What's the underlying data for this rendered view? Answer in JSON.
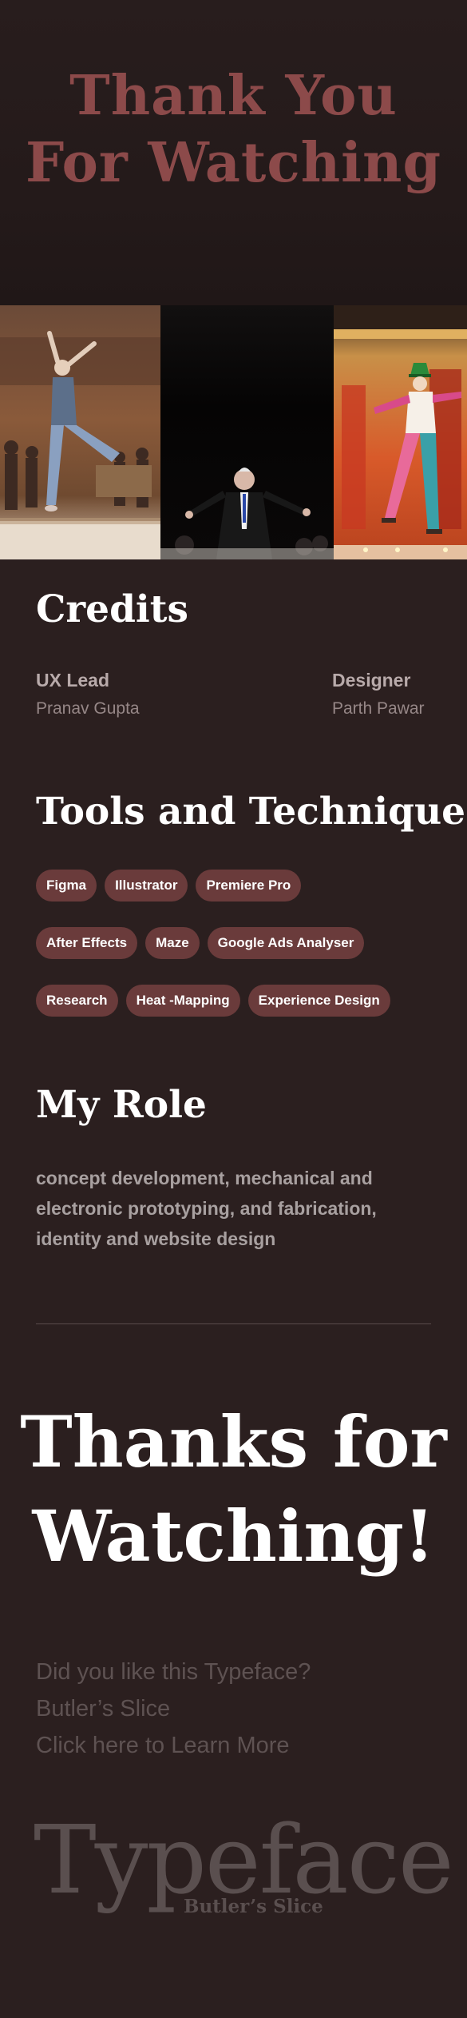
{
  "hero": {
    "title_line1": "Thank You",
    "title_line2": "For Watching"
  },
  "photos": [
    {
      "icon": "ballet-dancer-photo"
    },
    {
      "icon": "conductor-photo"
    },
    {
      "icon": "costumed-dancer-photo"
    }
  ],
  "credits": {
    "title": "Credits",
    "items": [
      {
        "role": "UX Lead",
        "name": "Pranav Gupta"
      },
      {
        "role": "Designer",
        "name": "Parth Pawar"
      }
    ]
  },
  "tools": {
    "title": "Tools and Techniques",
    "rows": [
      [
        "Figma",
        "Illustrator",
        "Premiere Pro"
      ],
      [
        "After Effects",
        "Maze",
        "Google Ads Analyser"
      ],
      [
        "Research",
        "Heat -Mapping",
        "Experience Design"
      ]
    ]
  },
  "role": {
    "title": "My Role",
    "text": "concept development, mechanical and electronic prototyping, and fabrication, identity and website design"
  },
  "closing": {
    "line1": "Thanks for",
    "line2": "Watching!"
  },
  "cta": {
    "question": "Did you like this Typeface?",
    "typeface_name": "Butler’s Slice",
    "link": "Click here to Learn More"
  },
  "typeface_mark": {
    "word": "Typeface",
    "subtitle": "Butler’s Slice"
  },
  "colors": {
    "background": "#2b1f1f",
    "hero_title": "#8c4a4a",
    "tag_background": "#6a3b3b",
    "muted_text": "#968787"
  }
}
